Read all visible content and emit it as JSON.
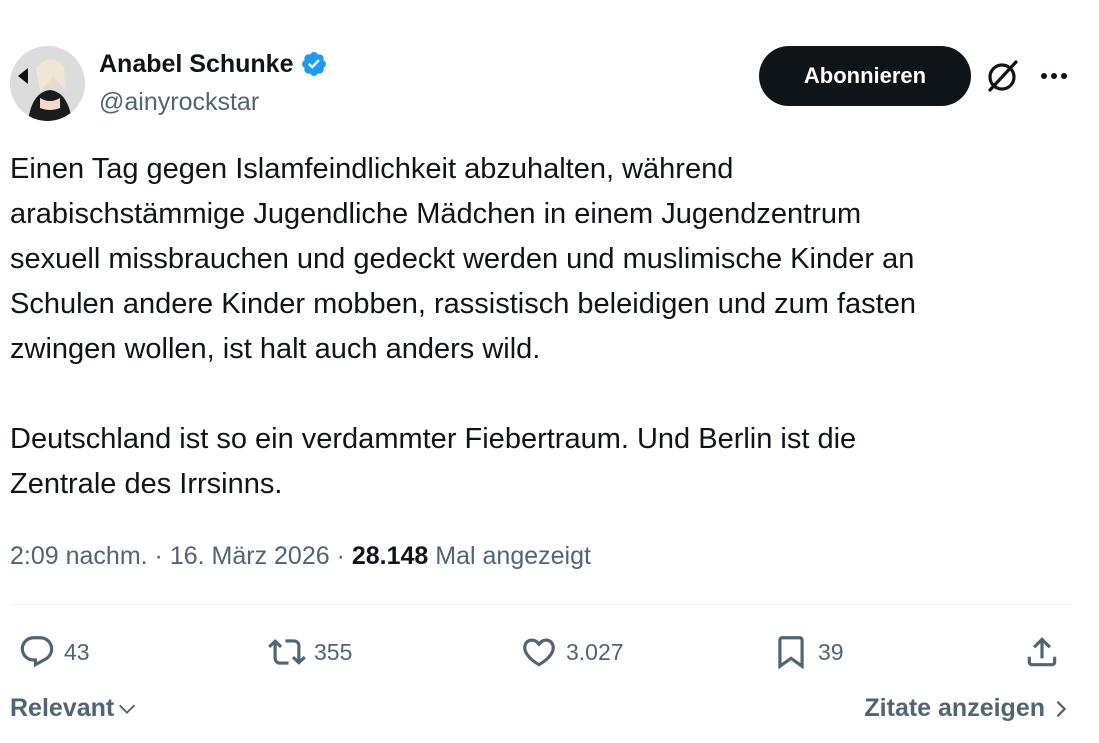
{
  "author": {
    "display_name": "Anabel Schunke",
    "handle": "@ainyrockstar",
    "verified": true,
    "verified_color": "#1d9bf0"
  },
  "header": {
    "follow_label": "Abonnieren",
    "grok_icon": "grok-icon",
    "more_icon": "more-icon"
  },
  "tweet": {
    "lines_p1": [
      "Einen Tag gegen Islamfeindlichkeit abzuhalten, während",
      "arabischstämmige Jugendliche Mädchen in einem Jugendzentrum",
      "sexuell missbrauchen und gedeckt werden und muslimische Kinder an",
      "Schulen andere Kinder mobben, rassistisch beleidigen und zum fasten",
      "zwingen wollen, ist halt auch anders wild."
    ],
    "lines_p2": [
      "Deutschland ist so ein verdammter Fiebertraum. Und Berlin ist die",
      "Zentrale des Irrsinns."
    ]
  },
  "meta": {
    "time": "2:09 nachm.",
    "sep1": " · ",
    "date": "16. März 2026",
    "sep2": " · ",
    "views_count": "28.148",
    "views_label": "Mal angezeigt"
  },
  "actions": {
    "replies": "43",
    "reposts": "355",
    "likes": "3.027",
    "bookmarks": "39"
  },
  "footer": {
    "sort_label": "Relevant",
    "quotes_label": "Zitate anzeigen"
  },
  "colors": {
    "text": "#0f1419",
    "secondary": "#536471",
    "button_bg": "#0f1419",
    "divider": "#eff3f4"
  }
}
